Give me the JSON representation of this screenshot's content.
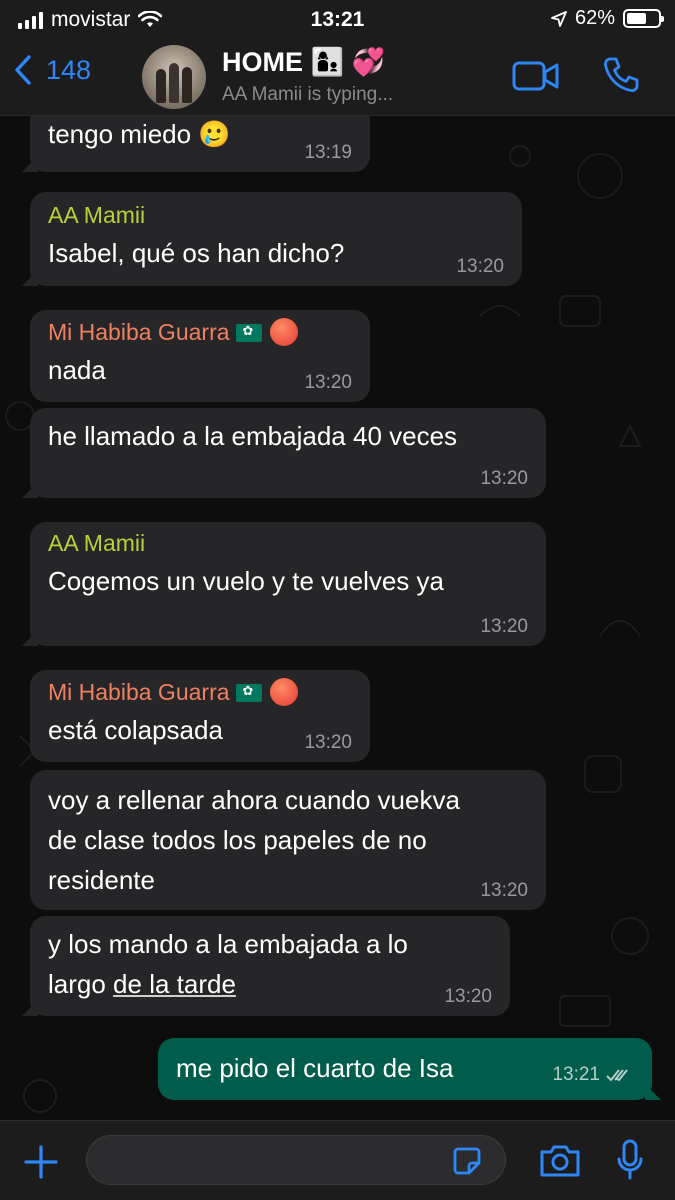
{
  "status_bar": {
    "carrier": "movistar",
    "time": "13:21",
    "battery": "62%"
  },
  "header": {
    "back_count": "148",
    "title": "HOME 👩‍👦 💞",
    "subtitle": "AA Mamii is typing..."
  },
  "messages": [
    {
      "id": "m0",
      "direction": "in",
      "text": "tengo miedo 🥲",
      "time": "13:19"
    },
    {
      "id": "m1",
      "direction": "in",
      "sender": "AA Mamii",
      "sender_color": "#b5d338",
      "text": "Isabel, qué os han dicho?",
      "time": "13:20"
    },
    {
      "id": "m2",
      "direction": "in",
      "sender": "Mi Habiba Guarra",
      "sender_color": "#f08060",
      "text": "nada",
      "time": "13:20"
    },
    {
      "id": "m3",
      "direction": "in",
      "text": "he llamado a la embajada 40 veces",
      "time": "13:20"
    },
    {
      "id": "m4",
      "direction": "in",
      "sender": "AA Mamii",
      "sender_color": "#b5d338",
      "text": "Cogemos un vuelo y te vuelves ya",
      "time": "13:20"
    },
    {
      "id": "m5",
      "direction": "in",
      "sender": "Mi Habiba Guarra",
      "sender_color": "#f08060",
      "text": "está colapsada",
      "time": "13:20"
    },
    {
      "id": "m6",
      "direction": "in",
      "lines": [
        "voy a rellenar ahora cuando vuekva",
        "de clase todos los papeles de no",
        "residente"
      ],
      "time": "13:20"
    },
    {
      "id": "m7",
      "direction": "in",
      "lines": [
        "y los mando a la embajada a lo"
      ],
      "line2_prefix": "largo ",
      "line2_link": "de la tarde",
      "time": "13:20"
    },
    {
      "id": "m8",
      "direction": "out",
      "text": "me pido el cuarto de Isa",
      "time": "13:21",
      "read": true
    }
  ],
  "colors": {
    "accent": "#2f86f6",
    "outgoing": "#005c4b",
    "incoming": "#262628"
  },
  "icons": [
    "signal-icon",
    "wifi-icon",
    "location-icon",
    "battery-icon",
    "back-chevron-icon",
    "video-call-icon",
    "phone-icon",
    "plus-icon",
    "sticker-icon",
    "camera-icon",
    "microphone-icon",
    "double-check-icon"
  ]
}
